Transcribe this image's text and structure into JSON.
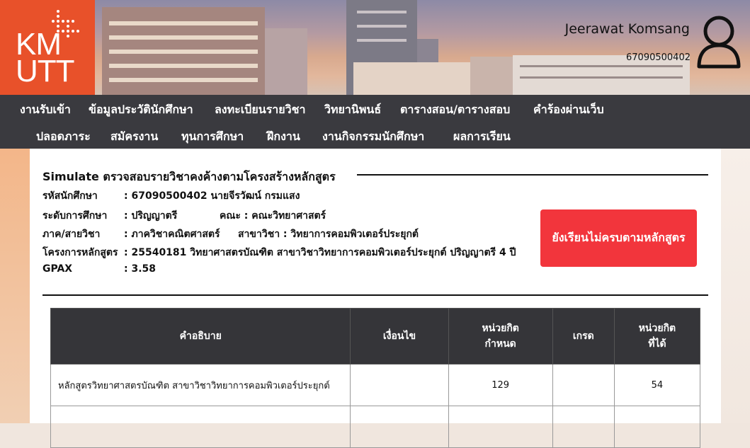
{
  "header": {
    "logo_text": "KMUTT",
    "user_name": "Jeerawat Komsang",
    "user_id": "67090500402",
    "avatar_icon": "user-avatar-icon"
  },
  "nav": {
    "row1": [
      "งานรับเข้า",
      "ข้อมูลประวัตินักศึกษา",
      "ลงทะเบียนรายวิชา",
      "วิทยานิพนธ์",
      "ตารางสอน/ตารางสอบ",
      "คำร้องผ่านเว็บ"
    ],
    "row2": [
      "ปลอดภาระ",
      "สมัครงาน",
      "ทุนการศึกษา",
      "ฝึกงาน",
      "งานกิจกรรมนักศึกษา",
      "ผลการเรียน"
    ]
  },
  "page": {
    "title": "Simulate ตรวจสอบรายวิชาคงค้างตามโครงสร้างหลักสูตร",
    "student_id_label": "รหัสนักศึกษา",
    "student_id_value": ": 67090500402 นายจีรวัฒน์ กรมแสง",
    "level_label": "ระดับการศึกษา",
    "level_value": ": ปริญญาตรี",
    "faculty_value": "คณะ : คณะวิทยาศาสตร์",
    "dept_label": "ภาค/สายวิชา",
    "dept_value": ": ภาควิชาคณิตศาสตร์",
    "major_value": "สาขาวิชา : วิทยาการคอมพิวเตอร์ประยุกต์",
    "program_label": "โครงการหลักสูตร",
    "program_value": ": 25540181 วิทยาศาสตรบัณฑิต สาขาวิชาวิทยาการคอมพิวเตอร์ประยุกต์ ปริญญาตรี 4 ปี",
    "gpax_label": "GPAX",
    "gpax_value": ": 3.58",
    "status": "ยังเรียนไม่ครบตามหลักสูตร",
    "status_color": "#f2353c"
  },
  "table": {
    "headers": [
      "คำอธิบาย",
      "เงื่อนไข",
      "หน่วยกิต\nกำหนด",
      "เกรด",
      "หน่วยกิต\nที่ได้"
    ],
    "rows": [
      {
        "desc": "หลักสูตรวิทยาศาสตรบัณฑิต สาขาวิชาวิทยาการคอมพิวเตอร์ประยุกต์",
        "cond": "",
        "credit_required": "129",
        "grade": "",
        "credit_earned": "54"
      }
    ]
  }
}
